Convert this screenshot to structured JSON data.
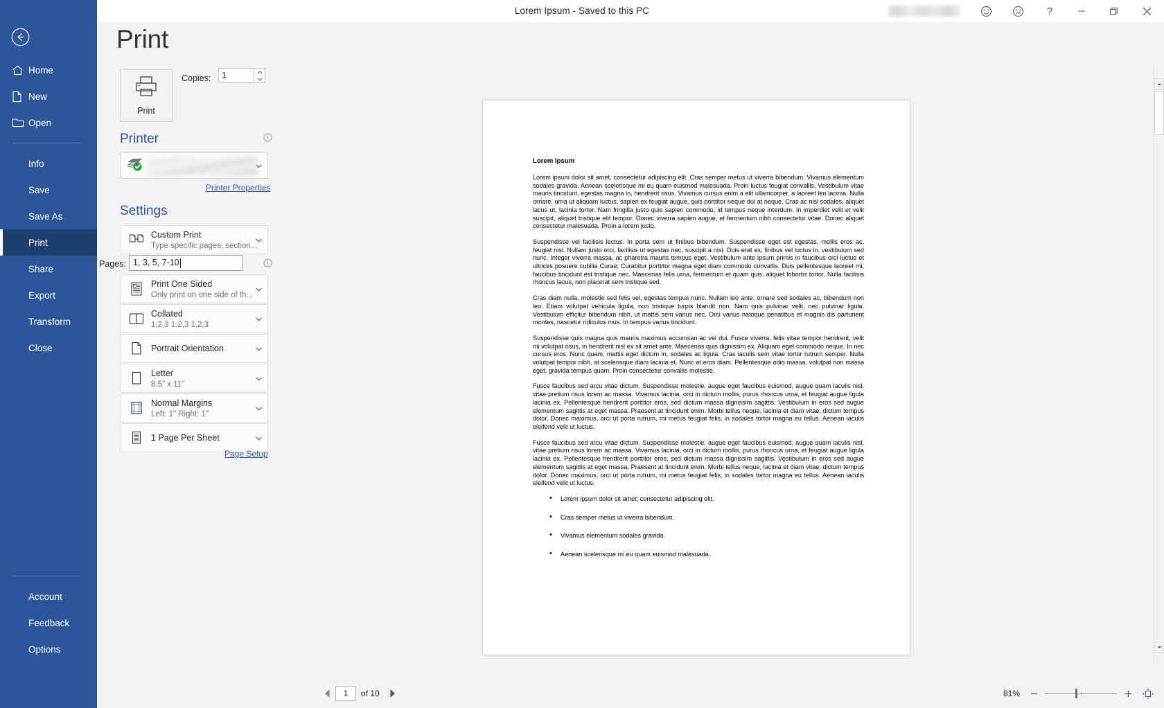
{
  "titlebar": {
    "title": "Lorem Ipsum  -  Saved to this PC",
    "icons": {
      "smile": "smiley-icon",
      "frown": "frown-icon",
      "help": "?",
      "minimize": "minimize-icon",
      "restore": "restore-icon",
      "close": "close-icon"
    }
  },
  "sidebar": {
    "back": "back-arrow",
    "items": [
      {
        "label": "Home",
        "icon": "home-icon"
      },
      {
        "label": "New",
        "icon": "new-document-icon"
      },
      {
        "label": "Open",
        "icon": "open-folder-icon"
      }
    ],
    "items2": [
      {
        "label": "Info"
      },
      {
        "label": "Save"
      },
      {
        "label": "Save As"
      },
      {
        "label": "Print",
        "active": true
      },
      {
        "label": "Share"
      },
      {
        "label": "Export"
      },
      {
        "label": "Transform"
      },
      {
        "label": "Close"
      }
    ],
    "bottom": [
      {
        "label": "Account"
      },
      {
        "label": "Feedback"
      },
      {
        "label": "Options"
      }
    ]
  },
  "print": {
    "page_title": "Print",
    "print_button_label": "Print",
    "copies_label": "Copies:",
    "copies_value": "1",
    "printer_heading": "Printer",
    "printer_name": "",
    "printer_properties_link": "Printer Properties",
    "settings_heading": "Settings",
    "page_setup_link": "Page Setup",
    "pages_label": "Pages:",
    "pages_value": "1, 3, 5, 7-10",
    "settings": [
      {
        "icon": "custom-print-icon",
        "title": "Custom Print",
        "subtitle": "Type specific pages, section..."
      },
      {
        "icon": "one-sided-icon",
        "title": "Print One Sided",
        "subtitle": "Only print on one side of th..."
      },
      {
        "icon": "collated-icon",
        "title": "Collated",
        "subtitle": "1,2,3   1,2,3   1,2,3"
      },
      {
        "icon": "portrait-icon",
        "title": "Portrait Orientation",
        "subtitle": ""
      },
      {
        "icon": "paper-size-icon",
        "title": "Letter",
        "subtitle": "8.5\" x 11\""
      },
      {
        "icon": "margins-icon",
        "title": "Normal Margins",
        "subtitle": "Left:  1\"   Right:  1\""
      },
      {
        "icon": "pages-per-sheet-icon",
        "title": "1 Page Per Sheet",
        "subtitle": ""
      }
    ]
  },
  "document": {
    "heading": "Lorem Ipsum",
    "paragraphs": [
      "Lorem ipsum dolor sit amet, consectetur adipiscing elit. Cras semper metus ut viverra bibendum. Vivamus elementum sodales gravida. Aenean scelerisque mi eu quam euismod malesuada. Proin luctus feugiat convallis. Vestibulum vitae mauris tincidunt, egestas magna in, hendrerit risus. Vivamus cursus enim a elit ullamcorper, a laoreet leo lacinia. Nulla ornare, urna ut aliquam luctus, sapien ex feugiat augue, quis porttitor neque dui at neque. Cras ac nisl sodales, aliquet lacus ut, lacinia tortor. Nam fringilla justo quis sapien commodo, id tempus neque interdum. In imperdiet velit et velit suscipit, aliquet tristique elit tempor. Donec viverra sapien augue, et fermentum nibh consectetur vitae. Donec aliquet consectetur malesuada. Proin a lorem justo.",
      "Suspendisse vel facilisis lectus. In porta sem ut finibus bibendum. Suspendisse eget est egestas, mollis eros ac, feugiat nisi. Nullam justo orci, facilisis ut egestas nec, suscipit a nisi. Duis erat ex, finibus vel luctus in, vestibulum sed nunc. Integer viverra massa, ac pharetra mauris tempus eget. Vestibulum ante ipsum primis in faucibus orci luctus et ultrices posuere cubilia Curae; Curabitur porttitor magna eget diam commodo convallis. Duis pellentesque laoreet mi, faucibus tincidunt est tristique nec. Maecenas felis urna, fermentum et quam quis, aliquet lobortis tortor. Nulla facilisis rhoncus lacus, non placerat sem tristique sed.",
      "Cras diam nulla, molestie sed felis vel, egestas tempus nunc. Nullam leo ante, ornare sed sodales ac, bibendum non leo. Etiam volutpat vehicula ligula, non tristique turpis blandit non. Nam quis pulvinar velit, nec pulvinar ligula. Vestibulum efficitur bibendum nibh, ut mattis sem varius nec. Orci varius natoque penatibus et magnis dis parturient montes, nascetur ridiculus mus. In tempus varius tincidunt.",
      "Suspendisse quis magna quis mauris maximus accumsan ac vel dui. Fusce viverra, felis vitae tempor hendrerit, velit mi volutpat risus, in hendrerit nisl ex sit amet ante. Maecenas quis dignissim ex. Aliquam eget commodo neque. In nec cursus eros. Nunc quam, mattis eget dictum in, sodales ac ligula. Cras iaculis sem vitae tortor rutrum semper. Nulla volutpat tempor nibh, at scelerisque diam lacinia et. Nunc at eros diam. Pellentesque odio massa, volutpat non massa eget, gravida tempus quam. Proin consectetur convallis molestie.",
      "Fusce faucibus sed arcu vitae dictum. Suspendisse molestie, augue eget faucibus euismod, augue quam iaculis nisl, vitae pretium risus lorem ac massa. Vivamus lacinia, orci in dictum mollis, purus rhoncus urna, et feugiat augue ligula lacinia ex. Pellentesque hendrerit porttitor eros, sed dictum massa dignissim sagittis. Vestibulum in eros sed augue elementum sagittis at eget massa. Praesent at tincidunt enim. Morbi tellus neque, lacinia et diam vitae, dictum tempus dolor. Donec maximus, orci ut porta rutrum, mi metus feugiat felis, in sodales tortor magna eu tellus. Aenean iaculis eleifend velit ut luctus.",
      "Fusce faucibus sed arcu vitae dictum. Suspendisse molestie, augue eget faucibus euismod, augue quam iaculis nisl, vitae pretium risus lorem ac massa. Vivamus lacinia, orci in dictum mollis, purus rhoncus urna, et feugiat augue ligula lacinia ex. Pellentesque hendrerit porttitor eros, sed dictum massa dignissim sagittis. Vestibulum in eros sed augue elementum sagittis at eget massa. Praesent at tincidunt enim. Morbi tellus neque, lacinia et diam vitae, dictum tempus dolor. Donec maximus, orci ut porta rutrum, mi metus feugiat felis, in sodales tortor magna eu tellus. Aenean iaculis eleifend velit ut luctus."
    ],
    "bullets": [
      "Lorem ipsum dolor sit amet, consectetur adipiscing elit.",
      "Cras semper metus ut viverra bibendum.",
      "Vivamus elementum sodales gravida.",
      "Aenean scelerisque mi eu quam euismod malesuada."
    ]
  },
  "statusbar": {
    "current_page": "1",
    "of_label": "of 10",
    "zoom_percent": "81%",
    "zoom_out": "−",
    "zoom_in": "+"
  },
  "colors": {
    "brand": "#2b579a",
    "brand_active": "#1e3f6f",
    "pane_bg": "#f3f3f3",
    "link": "#2b579a",
    "status_green": "#1d9b3f"
  }
}
